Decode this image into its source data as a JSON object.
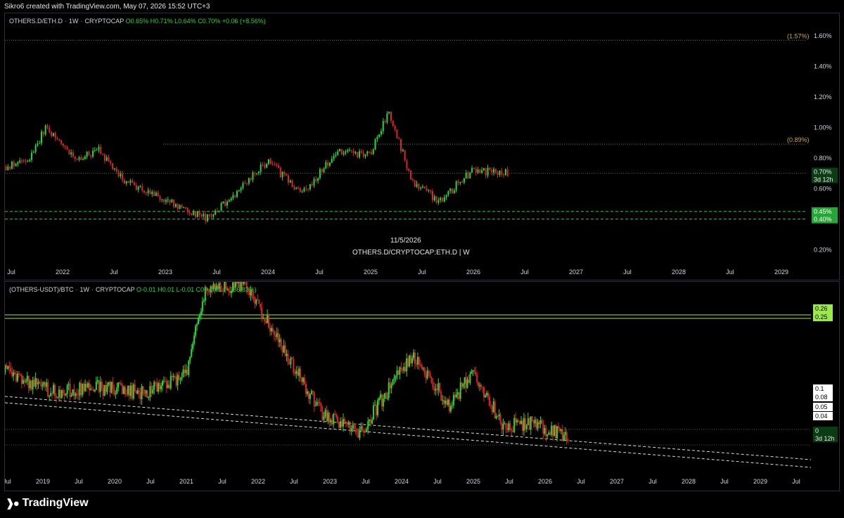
{
  "header": {
    "created_text": "Sikro6 created with TradingView.com, May 07, 2026 15:52 UTC+3"
  },
  "pane1": {
    "symbol": "OTHERS.D/ETH.D",
    "interval": "1W",
    "exchange": "CRYPTOCAP",
    "ohlc": {
      "o": "O0.65%",
      "h": "H0.71%",
      "l": "L0.64%",
      "c": "C0.70%",
      "change": "+0.06 (+8.56%)"
    },
    "watermark_date": "11/5/2026",
    "watermark_symbol": "OTHERS.D/CRYPTOCAP:ETH.D | W"
  },
  "pane2": {
    "symbol": "(OTHERS-USDT)/BTC",
    "interval": "1W",
    "exchange": "CRYPTOCAP",
    "ohlc": {
      "o": "O-0.01",
      "h": "H0.01",
      "l": "L-0.01",
      "c": "C0",
      "change": "+0.01 (+186.83%)"
    }
  },
  "brand": {
    "logo_text": "TradingView"
  },
  "colors": {
    "up": "#26d936",
    "down": "#e0232b",
    "lime": "#9be84a",
    "gold": "#c9a84a",
    "green_label": "#26a637"
  },
  "chart_data": [
    {
      "type": "candlestick",
      "title": "OTHERS.D/CRYPTOCAP:ETH.D",
      "x_axis_ticks": [
        "Jul",
        "2022",
        "Jul",
        "2023",
        "Jul",
        "2024",
        "Jul",
        "2025",
        "Jul",
        "2026",
        "Jul",
        "2027",
        "Jul",
        "2028",
        "Jul",
        "2029"
      ],
      "y_axis_ticks": [
        "1.60%",
        "1.40%",
        "1.20%",
        "1.00%",
        "0.80%",
        "0.60%",
        "0.20%"
      ],
      "ylim": [
        0.1,
        1.7
      ],
      "price_labels": [
        {
          "text": "0.70%",
          "sub": "3d 12h",
          "value": 0.7,
          "kind": "last"
        },
        {
          "text": "0.45%",
          "value": 0.45,
          "kind": "green"
        },
        {
          "text": "0.40%",
          "value": 0.4,
          "kind": "green"
        }
      ],
      "level_labels": [
        {
          "text": "(1.57%)",
          "value": 1.57
        },
        {
          "text": "(0.89%)",
          "value": 0.89
        }
      ],
      "trend_points": [
        [
          "2021-05",
          0.72
        ],
        [
          "2021-09",
          0.78
        ],
        [
          "2021-11",
          1.0
        ],
        [
          "2022-03",
          0.78
        ],
        [
          "2022-05",
          0.86
        ],
        [
          "2022-08",
          0.66
        ],
        [
          "2023-01",
          0.52
        ],
        [
          "2023-06",
          0.4
        ],
        [
          "2023-10",
          0.62
        ],
        [
          "2024-01",
          0.78
        ],
        [
          "2024-05",
          0.56
        ],
        [
          "2024-09",
          0.84
        ],
        [
          "2025-01",
          0.82
        ],
        [
          "2025-03",
          1.1
        ],
        [
          "2025-06",
          0.64
        ],
        [
          "2025-09",
          0.52
        ],
        [
          "2026-01",
          0.72
        ],
        [
          "2026-05",
          0.7
        ]
      ]
    },
    {
      "type": "candlestick",
      "title": "(OTHERS-USDT)/BTC",
      "x_axis_ticks": [
        "Jul",
        "2019",
        "Jul",
        "2020",
        "Jul",
        "2021",
        "Jul",
        "2022",
        "Jul",
        "2023",
        "Jul",
        "2024",
        "Jul",
        "2025",
        "Jul",
        "2026",
        "Jul",
        "2027",
        "Jul",
        "2028",
        "Jul",
        "2029",
        "Jul"
      ],
      "price_labels": [
        {
          "text": "0.26",
          "kind": "lime"
        },
        {
          "text": "0.25",
          "kind": "lime"
        },
        {
          "text": "0.1",
          "kind": "white"
        },
        {
          "text": "0.08",
          "kind": "white"
        },
        {
          "text": "0.05",
          "kind": "white"
        },
        {
          "text": "0.04",
          "kind": "white"
        },
        {
          "text": "0",
          "sub": "3d 12h",
          "kind": "last"
        }
      ],
      "trend_points": [
        [
          "2018-06",
          0.55
        ],
        [
          "2019-03",
          0.42
        ],
        [
          "2019-09",
          0.45
        ],
        [
          "2020-06",
          0.42
        ],
        [
          "2021-01",
          0.52
        ],
        [
          "2021-04",
          0.95
        ],
        [
          "2021-11",
          1.0
        ],
        [
          "2022-05",
          0.65
        ],
        [
          "2022-12",
          0.3
        ],
        [
          "2023-06",
          0.2
        ],
        [
          "2024-01",
          0.55
        ],
        [
          "2024-03",
          0.62
        ],
        [
          "2024-09",
          0.36
        ],
        [
          "2025-01",
          0.52
        ],
        [
          "2025-06",
          0.25
        ],
        [
          "2025-11",
          0.26
        ],
        [
          "2026-05",
          0.18
        ]
      ]
    }
  ]
}
